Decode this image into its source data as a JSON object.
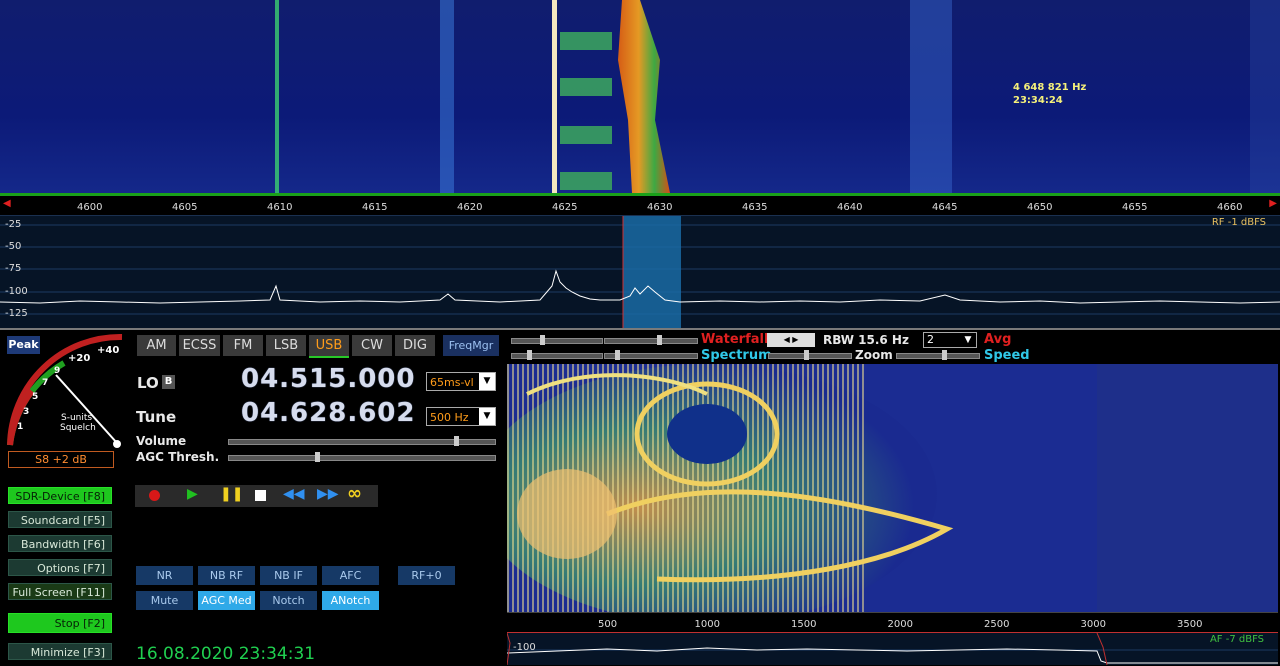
{
  "waterfall_top": {
    "marker_freq": "4 648 821 Hz",
    "marker_time": "23:34:24"
  },
  "freq_ruler": {
    "labels": [
      "4600",
      "4605",
      "4610",
      "4615",
      "4620",
      "4625",
      "4630",
      "4635",
      "4640",
      "4645",
      "4650",
      "4655",
      "4660"
    ]
  },
  "spectrum": {
    "db_labels": [
      "-25",
      "-50",
      "-75",
      "-100",
      "-125"
    ],
    "rf_level": "RF  -1 dBFS"
  },
  "smeter": {
    "peak_label": "Peak",
    "scale": [
      "+40",
      "+20",
      "9",
      "7",
      "5",
      "3",
      "1"
    ],
    "s_units": "S-units",
    "squelch": "Squelch",
    "reading": "S8 +2 dB"
  },
  "side_buttons": [
    {
      "label": "SDR-Device  [F8]",
      "on": true
    },
    {
      "label": "Soundcard  [F5]",
      "on": false
    },
    {
      "label": "Bandwidth  [F6]",
      "on": false
    },
    {
      "label": "Options  [F7]",
      "on": false
    },
    {
      "label": "Full Screen  [F11]",
      "on": false
    },
    {
      "label": "Stop  [F2]",
      "on": true
    },
    {
      "label": "Minimize  [F3]",
      "on": false
    }
  ],
  "modes": {
    "items": [
      "AM",
      "ECSS",
      "FM",
      "LSB",
      "USB",
      "CW",
      "DIG"
    ],
    "selected": "USB",
    "freqmgr": "FreqMgr"
  },
  "lo": {
    "label": "LO",
    "badge": "B",
    "freq": "04.515.000",
    "combo": "65ms-vl"
  },
  "tune": {
    "label": "Tune",
    "freq": "04.628.602",
    "combo": "500 Hz"
  },
  "sliders": {
    "volume": "Volume",
    "agc": "AGC Thresh.",
    "volume_level": 0.86,
    "agc_level": 0.33
  },
  "dsp": {
    "row1": [
      "NR",
      "NB RF",
      "NB IF",
      "AFC",
      "RF+0"
    ],
    "row2": [
      "Mute",
      "AGC Med",
      "Notch",
      "ANotch"
    ],
    "row2_on": [
      false,
      true,
      false,
      true
    ]
  },
  "datetime": "16.08.2020 23:34:31",
  "right_controls": {
    "waterfall": "Waterfall",
    "rbw": "RBW 15.6 Hz",
    "rbw_select": "2",
    "avg": "Avg",
    "spectrum": "Spectrum",
    "zoom": "Zoom",
    "speed": "Speed"
  },
  "af_ruler": {
    "labels": [
      "500",
      "1000",
      "1500",
      "2000",
      "2500",
      "3000",
      "3500"
    ]
  },
  "af_spec": {
    "db_label": "-100",
    "af_level": "AF  -7 dBFS"
  },
  "colors": {
    "green_on": "#1ec81e",
    "orange": "#ff9c1a",
    "dsp_on": "#2fa9e8",
    "red": "#e02020",
    "cyan": "#30c8e8"
  }
}
